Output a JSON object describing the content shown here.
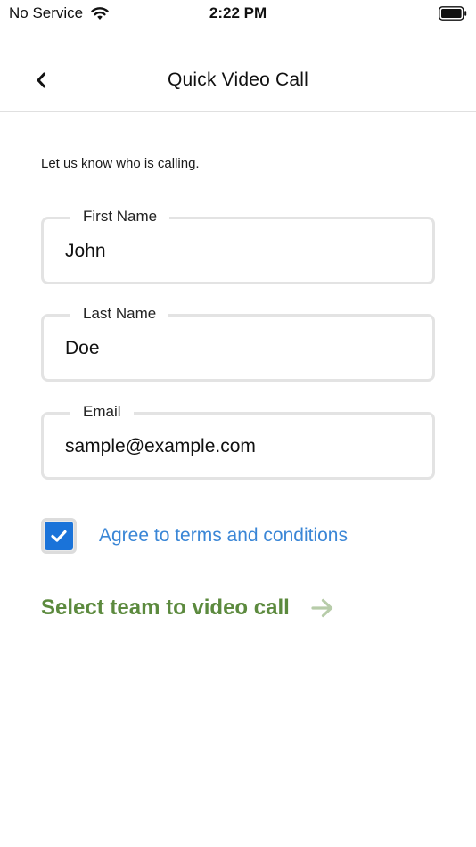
{
  "status_bar": {
    "carrier": "No Service",
    "time": "2:22 PM",
    "wifi_icon": "wifi-icon",
    "battery_icon": "battery-icon"
  },
  "nav": {
    "back_icon": "chevron-left-icon",
    "title": "Quick Video Call"
  },
  "form": {
    "intro": "Let us know who is calling.",
    "first_name": {
      "label": "First Name",
      "value": "John"
    },
    "last_name": {
      "label": "Last Name",
      "value": "Doe"
    },
    "email": {
      "label": "Email",
      "value": "sample@example.com"
    },
    "terms": {
      "label": "Agree to terms and conditions",
      "checked": true
    }
  },
  "cta": {
    "label": "Select team to video call",
    "icon": "arrow-right-icon"
  },
  "colors": {
    "checkbox_fill": "#1a73d9",
    "link_blue": "#3a86d6",
    "cta_green": "#5c8a3e",
    "cta_arrow": "#b7cca9",
    "field_border": "#e3e3e3"
  }
}
